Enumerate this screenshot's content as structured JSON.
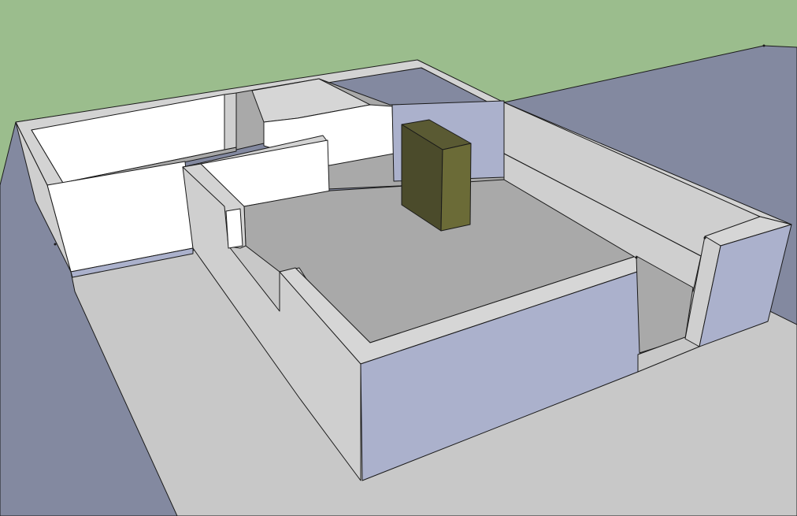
{
  "scene": {
    "colors": {
      "sky": "#9bbd8d",
      "ground": "#8389a0",
      "floor_dark": "#a9a9a9",
      "floor_light": "#c5c5c5",
      "wall_light": "#cfcfcf",
      "wall_white": "#ffffff",
      "wall_blue": "#abb1cc",
      "box_front": "#6b6b37",
      "box_side": "#4b4b2b"
    }
  }
}
